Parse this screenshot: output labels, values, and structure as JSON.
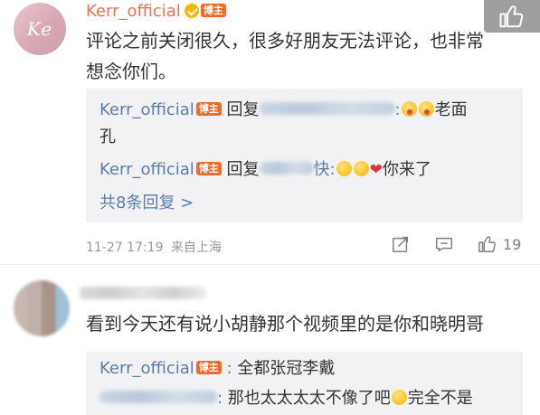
{
  "comment1": {
    "avatar_text": "Ke",
    "username": "Kerr_official",
    "author_tag": "博主",
    "text_line1": "评论之前关闭很久，很多好朋友无法评论，也非常",
    "text_line2": "想念你们。",
    "replies": [
      {
        "name": "Kerr_official",
        "tag": "博主",
        "reply_word": "回复",
        "after_emoji_text": "老面",
        "continuation": "孔"
      },
      {
        "name": "Kerr_official",
        "tag": "博主",
        "reply_word": "回复",
        "fragment": "快",
        "end_text": "你来了"
      }
    ],
    "more_replies": "共8条回复 >",
    "timestamp": "11-27 17:19",
    "location": "来自上海",
    "like_count": "19"
  },
  "comment2": {
    "text": "看到今天还有说小胡静那个视频里的是你和晓明哥",
    "replies": [
      {
        "name": "Kerr_official",
        "tag": "博主",
        "text": "全都张冠李戴"
      },
      {
        "text": "那也太太太太不像了吧",
        "text2": "完全不是"
      }
    ]
  },
  "icons": {
    "like": "thumbs-up-icon",
    "share": "share-icon",
    "comment": "comment-icon",
    "verified": "verified-badge-icon"
  },
  "colors": {
    "username": "#eb7350",
    "link": "#5b7ea6",
    "author_tag": "#f5682a",
    "reply_bg": "#f2f2f5"
  }
}
